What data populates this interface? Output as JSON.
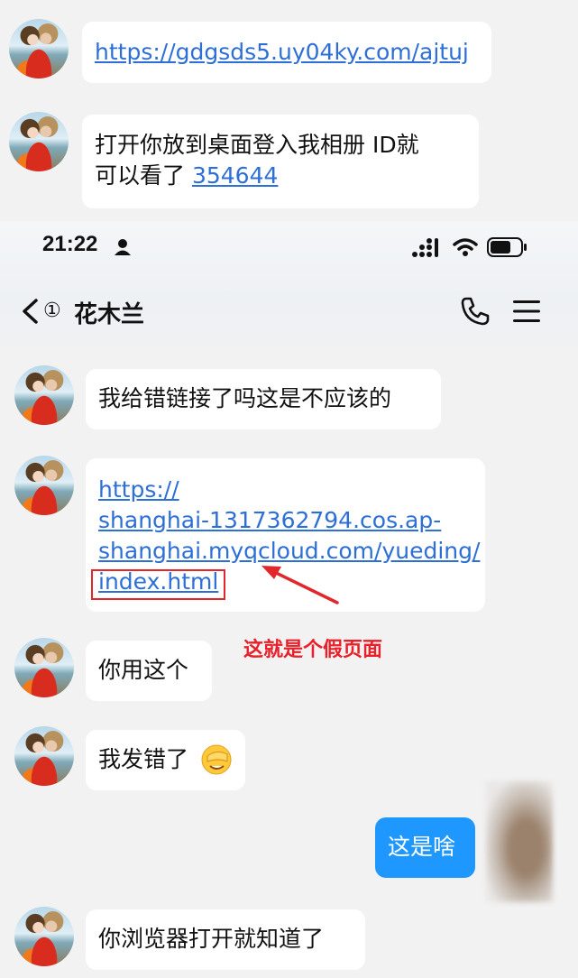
{
  "top_messages": [
    {
      "link": "https://gdgsds5.uy04ky.com/ajtuj"
    },
    {
      "text_line1": "打开你放到桌面登入我相册 ID就",
      "text_line2": "可以看了 ",
      "link": "354644"
    }
  ],
  "status_bar": {
    "time": "21:22"
  },
  "header": {
    "badge": "①",
    "contact_name": "花木兰"
  },
  "messages": [
    {
      "text": "我给错链接了吗这是不应该的"
    },
    {
      "link_lines": [
        "https://",
        "shanghai-1317362794.cos.ap-",
        "shanghai.myqcloud.com/yueding/",
        "index.html"
      ]
    },
    {
      "text": "你用这个"
    },
    {
      "text": "我发错了"
    },
    {
      "text": "这是啥",
      "outgoing": true
    },
    {
      "text": "你浏览器打开就知道了"
    }
  ],
  "annotation": {
    "text": "这就是个假页面",
    "color": "#e8202a"
  },
  "colors": {
    "link": "#2d6fd6",
    "outgoing_bubble": "#1e98ff",
    "background": "#f2f2f2"
  }
}
